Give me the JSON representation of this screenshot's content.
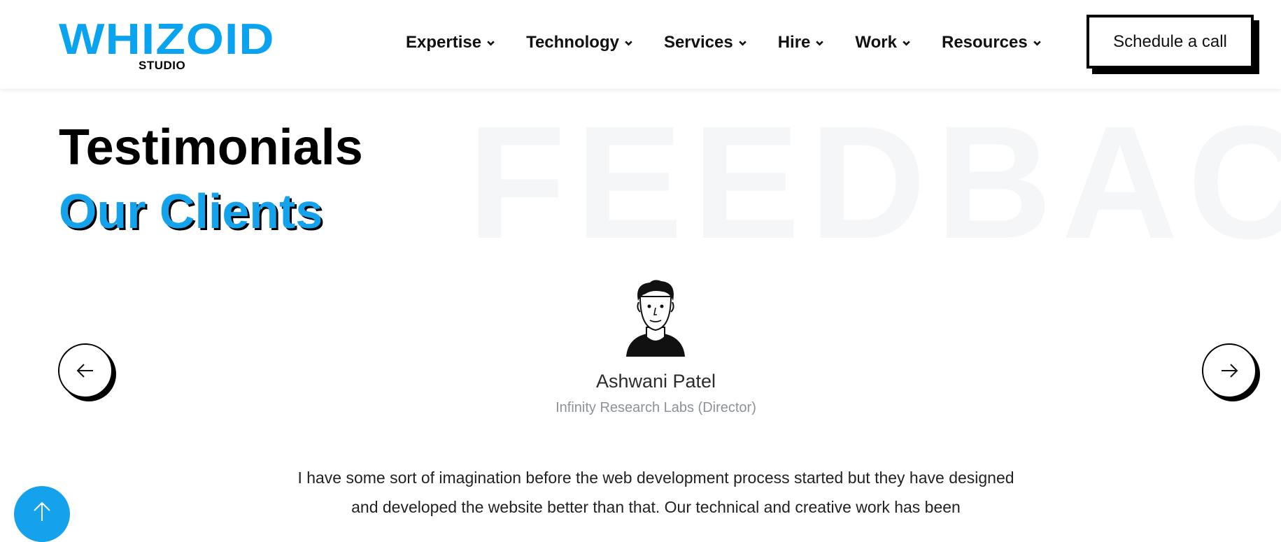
{
  "brand": {
    "name": "WHIZOID",
    "subname": "STUDIO",
    "accent_color": "#14a2ed"
  },
  "nav": {
    "items": [
      {
        "label": "Expertise",
        "icon": "chevron-down-icon"
      },
      {
        "label": "Technology",
        "icon": "chevron-down-icon"
      },
      {
        "label": "Services",
        "icon": "chevron-down-icon"
      },
      {
        "label": "Hire",
        "icon": "chevron-down-icon"
      },
      {
        "label": "Work",
        "icon": "chevron-down-icon"
      },
      {
        "label": "Resources",
        "icon": "chevron-down-icon"
      }
    ],
    "cta_label": "Schedule a call"
  },
  "section": {
    "watermark": "FEEDBAC",
    "title": "Testimonials",
    "subtitle": "Our Clients"
  },
  "testimonial": {
    "client_name": "Ashwani Patel",
    "client_role": "Infinity Research Labs (Director)",
    "text": "I have some sort of imagination before the web development process started but they have designed and developed the website better than that. Our technical and creative work has been",
    "avatar_icon": "person-avatar-icon",
    "prev_icon": "arrow-left-icon",
    "next_icon": "arrow-right-icon"
  },
  "scroll_top": {
    "icon": "arrow-up-icon"
  }
}
